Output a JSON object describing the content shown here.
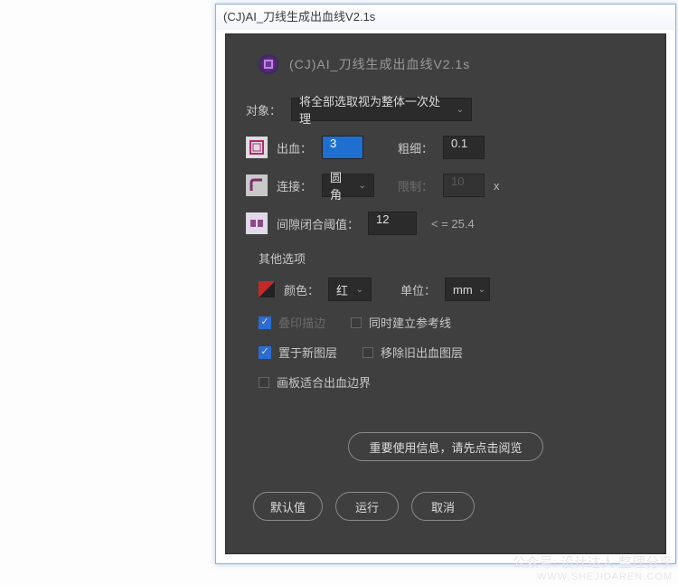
{
  "window": {
    "title": "(CJ)AI_刀线生成出血线V2.1s"
  },
  "header": {
    "icon": "logo-icon",
    "title": "(CJ)AI_刀线生成出血线V2.1s"
  },
  "object": {
    "label": "对象：",
    "select_value": "将全部选取视为整体一次处理"
  },
  "bleed": {
    "icon": "bleed-icon",
    "label": "出血：",
    "value": "3",
    "thickness_label": "粗细：",
    "thickness_value": "0.1"
  },
  "join": {
    "icon": "join-icon",
    "label": "连接：",
    "select_value": "圆角",
    "limit_label": "限制：",
    "limit_value": "10",
    "unit": "x"
  },
  "gap": {
    "icon": "gap-icon",
    "label": "间隙闭合阈值：",
    "value": "12",
    "hint": "< = 25.4"
  },
  "other": {
    "title": "其他选项",
    "color_label": "颜色：",
    "color_value": "红",
    "unit_label": "单位：",
    "unit_value": "mm",
    "cb_print": {
      "label": "叠印描边",
      "checked": true,
      "disabled": true
    },
    "cb_guide": {
      "label": "同时建立参考线",
      "checked": false
    },
    "cb_newlayer": {
      "label": "置于新图层",
      "checked": true
    },
    "cb_removeold": {
      "label": "移除旧出血图层",
      "checked": false
    },
    "cb_artboard": {
      "label": "画板适合出血边界",
      "checked": false
    }
  },
  "buttons": {
    "info": "重要使用信息，请先点击阅览",
    "default": "默认值",
    "run": "运行",
    "cancel": "取消"
  },
  "watermark": {
    "line1": "公众号: 设计达人 整理分享",
    "line2": "WWW.SHEJIDAREN.COM"
  }
}
